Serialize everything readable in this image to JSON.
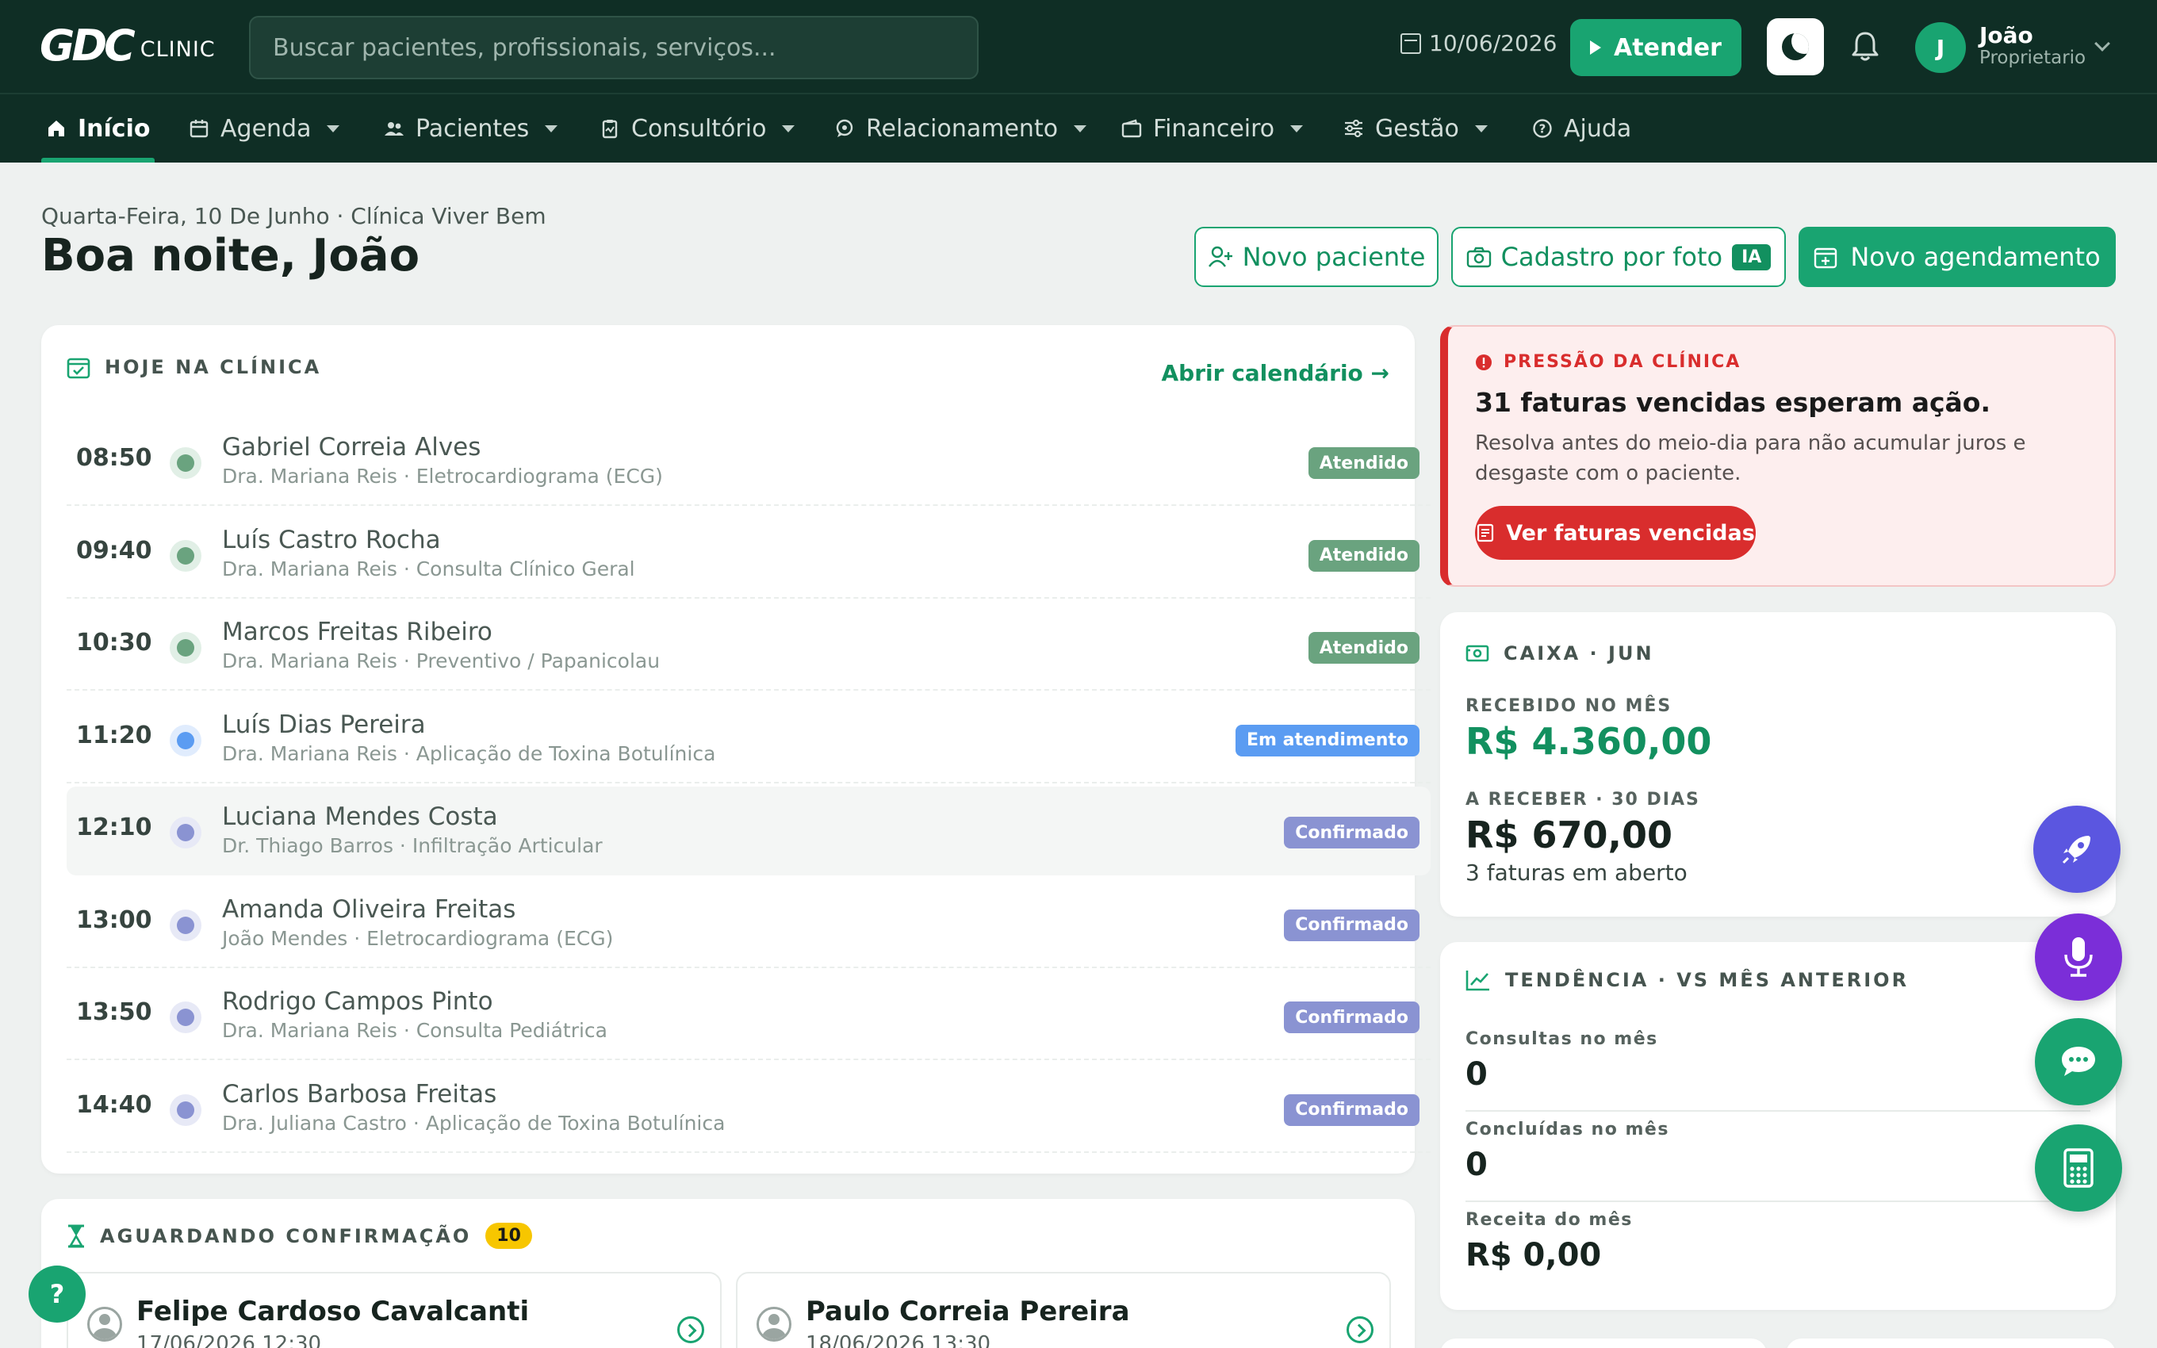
{
  "app": {
    "logo_mark": "GDC",
    "logo_text": "CLINIC",
    "search_placeholder": "Buscar pacientes, profissionais, serviços...",
    "date": "10/06/2026",
    "atender_label": "Atender",
    "user": {
      "initial": "J",
      "name": "João",
      "role": "Proprietario"
    }
  },
  "nav": [
    {
      "label": "Início",
      "icon": "home-icon",
      "active": true
    },
    {
      "label": "Agenda",
      "icon": "calendar-icon"
    },
    {
      "label": "Pacientes",
      "icon": "users-icon"
    },
    {
      "label": "Consultório",
      "icon": "clipboard-icon"
    },
    {
      "label": "Relacionamento",
      "icon": "chat-icon"
    },
    {
      "label": "Financeiro",
      "icon": "wallet-icon"
    },
    {
      "label": "Gestão",
      "icon": "sliders-icon"
    },
    {
      "label": "Ajuda",
      "icon": "help-icon"
    }
  ],
  "header": {
    "subtitle": "Quarta-Feira, 10 De Junho · Clínica Viver Bem",
    "greeting": "Boa noite, João",
    "new_patient": "Novo paciente",
    "photo_signup": "Cadastro por foto",
    "ia_badge": "IA",
    "new_appointment": "Novo agendamento"
  },
  "today": {
    "title": "HOJE NA CLÍNICA",
    "link": "Abrir calendário →",
    "appointments": [
      {
        "time": "08:50",
        "name": "Gabriel Correia Alves",
        "detail": "Dra. Mariana Reis · Eletrocardiograma (ECG)",
        "status": "Atendido",
        "kind": "done"
      },
      {
        "time": "09:40",
        "name": "Luís Castro Rocha",
        "detail": "Dra. Mariana Reis · Consulta Clínico Geral",
        "status": "Atendido",
        "kind": "done"
      },
      {
        "time": "10:30",
        "name": "Marcos Freitas Ribeiro",
        "detail": "Dra. Mariana Reis · Preventivo / Papanicolau",
        "status": "Atendido",
        "kind": "done"
      },
      {
        "time": "11:20",
        "name": "Luís Dias Pereira",
        "detail": "Dra. Mariana Reis · Aplicação de Toxina Botulínica",
        "status": "Em atendimento",
        "kind": "progress"
      },
      {
        "time": "12:10",
        "name": "Luciana Mendes Costa",
        "detail": "Dr. Thiago Barros · Infiltração Articular",
        "status": "Confirmado",
        "kind": "confirmed"
      },
      {
        "time": "13:00",
        "name": "Amanda Oliveira Freitas",
        "detail": "João Mendes · Eletrocardiograma (ECG)",
        "status": "Confirmado",
        "kind": "confirmed"
      },
      {
        "time": "13:50",
        "name": "Rodrigo Campos Pinto",
        "detail": "Dra. Mariana Reis · Consulta Pediátrica",
        "status": "Confirmado",
        "kind": "confirmed"
      },
      {
        "time": "14:40",
        "name": "Carlos Barbosa Freitas",
        "detail": "Dra. Juliana Castro · Aplicação de Toxina Botulínica",
        "status": "Confirmado",
        "kind": "confirmed"
      }
    ]
  },
  "pressure": {
    "title": "PRESSÃO DA CLÍNICA",
    "headline": "31 faturas vencidas esperam ação.",
    "description": "Resolva antes do meio-dia para não acumular juros e desgaste com o paciente.",
    "button": "Ver faturas vencidas"
  },
  "cash": {
    "title": "CAIXA · JUN",
    "received_label": "RECEBIDO NO MÊS",
    "received_value": "R$ 4.360,00",
    "receivable_label": "A RECEBER · 30 DIAS",
    "receivable_value": "R$ 670,00",
    "open_invoices": "3 faturas em aberto"
  },
  "trend": {
    "title": "TENDÊNCIA · VS MÊS ANTERIOR",
    "metrics": [
      {
        "label": "Consultas no mês",
        "value": "0"
      },
      {
        "label": "Concluídas no mês",
        "value": "0"
      },
      {
        "label": "Receita do mês",
        "value": "R$ 0,00"
      }
    ]
  },
  "waiting": {
    "title": "AGUARDANDO CONFIRMAÇÃO",
    "count": "10",
    "items": [
      {
        "name": "Felipe Cardoso Cavalcanti",
        "datetime": "17/06/2026 12:30"
      },
      {
        "name": "Paulo Correia Pereira",
        "datetime": "18/06/2026 13:30"
      }
    ]
  },
  "fabs": [
    "rocket-icon",
    "microphone-icon",
    "chat-bubble-icon",
    "calculator-icon"
  ],
  "help_fab": "?",
  "colors": {
    "brand_dark": "#0f2e25",
    "brand_green": "#19a471",
    "status_done": "#6aa37f",
    "status_progress": "#5b9cf2",
    "status_confirmed": "#8a93d2",
    "danger": "#d92d2d"
  }
}
